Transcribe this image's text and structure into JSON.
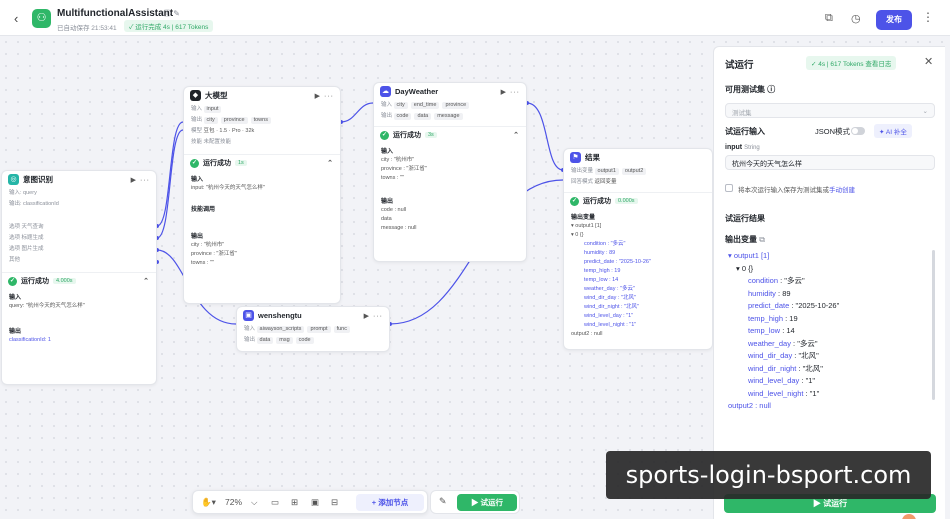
{
  "topbar": {
    "back": "‹",
    "app_name": "MultifunctionalAssistant",
    "title_icons": "ⓘ ✎",
    "autosave": "已自动保存 21:53:41",
    "run_status": "✓ 运行完成 4s | 617 Tokens",
    "publish": "发布",
    "more": "⋮"
  },
  "nodes": {
    "intent": {
      "title": "意图识别",
      "acts": "▶ ···",
      "rows": [
        "输入: query",
        "输出: classificationId"
      ],
      "branches": [
        "选项 天气查询",
        "选项 标题生成",
        "选项 图片生成",
        "其他"
      ],
      "result": "运行成功",
      "time": "4.000s",
      "input_label": "输入",
      "input_value": "query: \"杭州今天的天气怎么样\"",
      "output_label": "输出",
      "output_value": "classificationId: 1"
    },
    "llm": {
      "title": "大模型",
      "acts": "▶ ···",
      "input": "输入",
      "vars": [
        "input"
      ],
      "out": "输出",
      "outs": [
        "city",
        "province",
        "towns"
      ],
      "model": "模型",
      "model_name": "豆包 · 1.5 · Pro · 32k",
      "skill": "技能",
      "skill_value": "未配置技能",
      "result": "运行成功",
      "time": "1s",
      "in_label": "输入",
      "in_value": "input: \"杭州今天的天气怎么样\"",
      "skill_label": "技能调用",
      "out_label": "输出",
      "out_lines": [
        "city : \"杭州市\"",
        "province : \"浙江省\"",
        "towns : \"\""
      ]
    },
    "dayweather": {
      "title": "DayWeather",
      "acts": "▶ ···",
      "in_label": "输入",
      "ins": [
        "city",
        "end_time",
        "province"
      ],
      "out_label": "输出",
      "outs": [
        "code",
        "data",
        "message"
      ],
      "result": "运行成功",
      "time": "3s",
      "r_in": "输入",
      "r_in_lines": [
        "city : \"杭州市\"",
        "province : \"浙江省\"",
        "towns : \"\""
      ],
      "r_out": "输出",
      "r_out_lines": [
        "code : null",
        "data",
        "message : null"
      ]
    },
    "wensheng": {
      "title": "wenshengtu",
      "acts": "▶ ···",
      "in_label": "输入",
      "ins": [
        "aiwayson_scripts",
        "prompt",
        "func"
      ],
      "out_label": "输出",
      "outs": [
        "data",
        "msg",
        "code"
      ]
    },
    "end": {
      "title": "结果",
      "in_label": "输出变量",
      "ins": [
        "output1",
        "output2"
      ],
      "mode_label": "回答模式",
      "mode": "返回变量",
      "result": "运行成功",
      "time": "0.000s",
      "r_label": "输出变量",
      "tree": [
        "▾ output1 [1]",
        "  ▾ 0 {}",
        "condition : \"多云\"",
        "humidity : 89",
        "predict_date : \"2025-10-26\"",
        "temp_high : 19",
        "temp_low : 14",
        "weather_day : \"多云\"",
        "wind_dir_day : \"北风\"",
        "wind_dir_night : \"北风\"",
        "wind_level_day : \"1\"",
        "wind_level_night : \"1\"",
        "output2 : null"
      ]
    }
  },
  "panel": {
    "title": "试运行",
    "badge": "✓ 4s | 617 Tokens  查看日志",
    "close": "✕",
    "dataset_label": "可用测试集 ⓘ",
    "dataset_placeholder": "测试集",
    "input_label": "试运行输入",
    "json_mode": "JSON模式",
    "ai_fill": "✦ AI 补全",
    "input_name": "input",
    "input_type": "String",
    "input_value": "杭州今天的天气怎么样",
    "save_note": "将本次运行输入保存为测试集或",
    "save_link": "手动创建",
    "result_label": "试运行结果",
    "output_label": "输出变量",
    "output": {
      "output1_line": "▾ output1 [1]",
      "item0_line": "▾ 0 {}",
      "fields": [
        {
          "key": "condition",
          "value": "\"多云\""
        },
        {
          "key": "humidity",
          "value": "89"
        },
        {
          "key": "predict_date",
          "value": "\"2025-10-26\""
        },
        {
          "key": "temp_high",
          "value": "19"
        },
        {
          "key": "temp_low",
          "value": "14"
        },
        {
          "key": "weather_day",
          "value": "\"多云\""
        },
        {
          "key": "wind_dir_day",
          "value": "\"北风\""
        },
        {
          "key": "wind_dir_night",
          "value": "\"北风\""
        },
        {
          "key": "wind_level_day",
          "value": "\"1\""
        },
        {
          "key": "wind_level_night",
          "value": "\"1\""
        }
      ],
      "output2_line": "output2 : null"
    },
    "run": "▶ 试运行"
  },
  "bottombar": {
    "hand": "✋▾",
    "zoom": "72%",
    "zoom_caret": "⌵",
    "icons": [
      "▭",
      "⊞",
      "▣",
      "⊟"
    ],
    "add_node": "+ 添加节点",
    "edit": "✎",
    "test_run": "▶ 试运行"
  },
  "watermark": "sports-login-bsport.com",
  "colors": {
    "accent": "#4d53e8",
    "success": "#2fb768"
  }
}
